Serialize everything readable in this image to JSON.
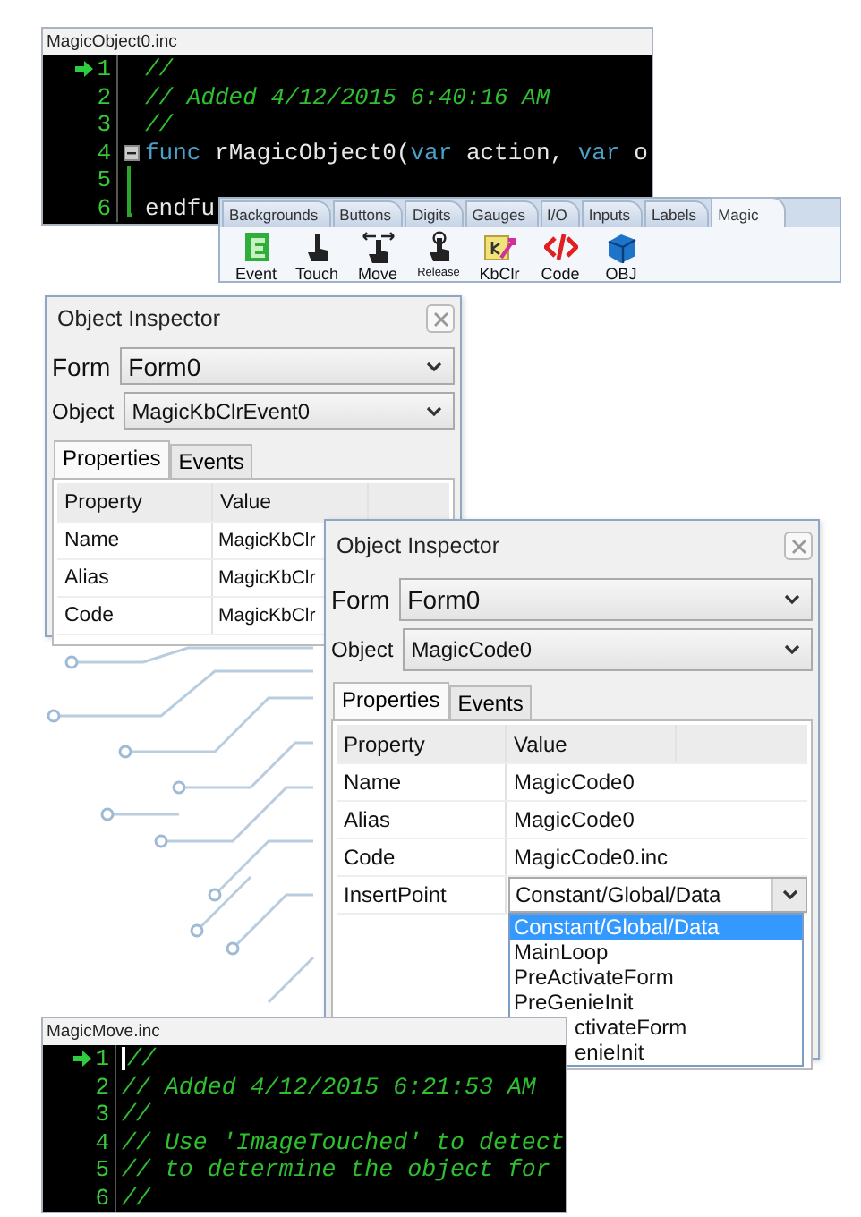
{
  "code_editors": [
    {
      "title": "MagicObject0.inc",
      "lines": [
        {
          "number": "1",
          "current": true,
          "cursor": false,
          "tokens": [
            {
              "kind": "comment",
              "text": "//"
            }
          ]
        },
        {
          "number": "2",
          "current": false,
          "cursor": false,
          "tokens": [
            {
              "kind": "comment",
              "text": "// Added 4/12/2015 6:40:16 AM"
            }
          ]
        },
        {
          "number": "3",
          "current": false,
          "cursor": false,
          "tokens": [
            {
              "kind": "comment",
              "text": "//"
            }
          ]
        },
        {
          "number": "4",
          "current": false,
          "cursor": false,
          "tokens": [
            {
              "kind": "keyword",
              "text": "func"
            },
            {
              "kind": "plain",
              "text": " rMagicObject0("
            },
            {
              "kind": "keyword",
              "text": "var"
            },
            {
              "kind": "plain",
              "text": " action, "
            },
            {
              "kind": "keyword",
              "text": "var"
            },
            {
              "kind": "plain",
              "text": " o"
            }
          ],
          "children": [
            {
              "number": "5",
              "current": false,
              "cursor": false
            },
            {
              "number": "6",
              "current": false,
              "cursor": false,
              "tokens": [
                {
                  "kind": "plain",
                  "text": "endfu"
                }
              ]
            }
          ]
        }
      ]
    },
    {
      "title": "MagicMove.inc",
      "lines": [
        {
          "number": "1",
          "current": true,
          "cursor": true,
          "tokens": [
            {
              "kind": "comment",
              "text": "//"
            }
          ]
        },
        {
          "number": "2",
          "current": false,
          "cursor": false,
          "tokens": [
            {
              "kind": "comment",
              "text": "// Added 4/12/2015 6:21:53 AM"
            }
          ]
        },
        {
          "number": "3",
          "current": false,
          "cursor": false,
          "tokens": [
            {
              "kind": "comment",
              "text": "//"
            }
          ]
        },
        {
          "number": "4",
          "current": false,
          "cursor": false,
          "tokens": [
            {
              "kind": "comment",
              "text": "// Use 'ImageTouched' to detect"
            }
          ]
        },
        {
          "number": "5",
          "current": false,
          "cursor": false,
          "tokens": [
            {
              "kind": "comment",
              "text": "// to determine the object for"
            }
          ]
        },
        {
          "number": "6",
          "current": false,
          "cursor": false,
          "tokens": [
            {
              "kind": "comment",
              "text": "//"
            }
          ]
        }
      ]
    }
  ],
  "widget_palette": {
    "tabs": [
      {
        "label": "Backgrounds",
        "selected": false
      },
      {
        "label": "Buttons",
        "selected": false
      },
      {
        "label": "Digits",
        "selected": false
      },
      {
        "label": "Gauges",
        "selected": false
      },
      {
        "label": "I/O",
        "selected": false
      },
      {
        "label": "Inputs",
        "selected": false
      },
      {
        "label": "Labels",
        "selected": false
      },
      {
        "label": "Magic",
        "selected": true
      }
    ],
    "tools": [
      {
        "kind": "event",
        "label": "Event"
      },
      {
        "kind": "touch",
        "label": "Touch"
      },
      {
        "kind": "move",
        "label": "Move"
      },
      {
        "kind": "release",
        "label": "Release"
      },
      {
        "kind": "kbclr",
        "label": "KbClr"
      },
      {
        "kind": "code",
        "label": "Code"
      },
      {
        "kind": "obj",
        "label": "OBJ"
      }
    ]
  },
  "object_inspectors": [
    {
      "title": "Object Inspector",
      "form": {
        "label": "Form",
        "value": "Form0"
      },
      "object": {
        "label": "Object",
        "value": "MagicKbClrEvent0"
      },
      "tabs": [
        {
          "label": "Properties",
          "selected": true
        },
        {
          "label": "Events",
          "selected": false
        }
      ],
      "columns": [
        "Property",
        "Value"
      ],
      "rows": [
        {
          "property": "Name",
          "value": "MagicKbClr"
        },
        {
          "property": "Alias",
          "value": "MagicKbClr"
        },
        {
          "property": "Code",
          "value": "MagicKbClr"
        }
      ]
    },
    {
      "title": "Object Inspector",
      "form": {
        "label": "Form",
        "value": "Form0"
      },
      "object": {
        "label": "Object",
        "value": "MagicCode0"
      },
      "tabs": [
        {
          "label": "Properties",
          "selected": true
        },
        {
          "label": "Events",
          "selected": false
        }
      ],
      "columns": [
        "Property",
        "Value"
      ],
      "rows": [
        {
          "property": "Name",
          "value": "MagicCode0"
        },
        {
          "property": "Alias",
          "value": "MagicCode0"
        },
        {
          "property": "Code",
          "value": "MagicCode0.inc"
        },
        {
          "property": "InsertPoint",
          "value": "Constant/Global/Data",
          "options": [
            {
              "text": "Constant/Global/Data",
              "selected": true,
              "clipped": false
            },
            {
              "text": "MainLoop",
              "selected": false,
              "clipped": false
            },
            {
              "text": "PreActivateForm",
              "selected": false,
              "clipped": false
            },
            {
              "text": "PreGenieInit",
              "selected": false,
              "clipped": false
            },
            {
              "text": "ctivateForm",
              "selected": false,
              "clipped": true
            },
            {
              "text": "enieInit",
              "selected": false,
              "clipped": true
            }
          ]
        }
      ]
    }
  ]
}
